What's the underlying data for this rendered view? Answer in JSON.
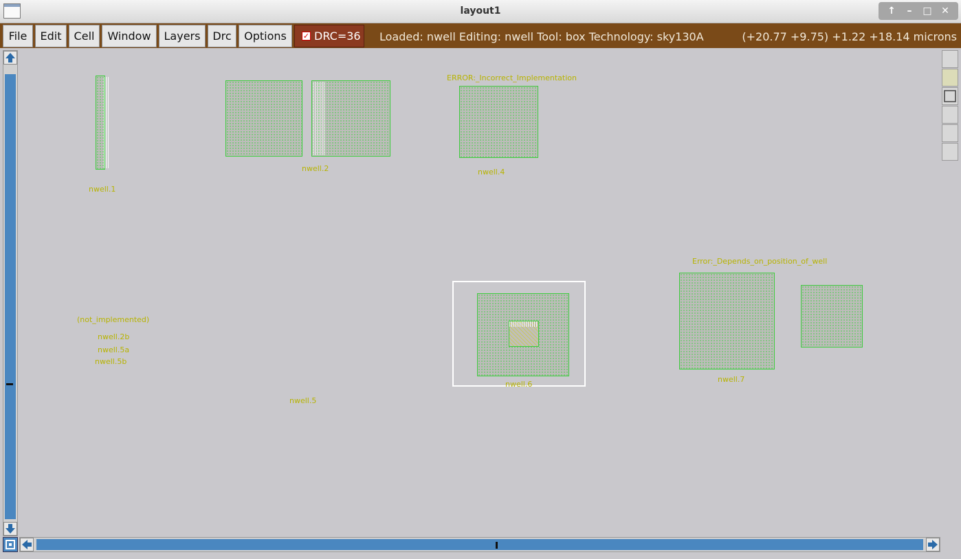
{
  "window": {
    "title": "layout1"
  },
  "menu": [
    "File",
    "Edit",
    "Cell",
    "Window",
    "Layers",
    "Drc",
    "Options"
  ],
  "drc": {
    "label": "DRC=36",
    "checked": true
  },
  "status": {
    "text": "Loaded: nwell Editing: nwell Tool: box  Technology: sky130A",
    "coords": "(+20.77 +9.75) +1.22 +18.14 microns"
  },
  "canvas_labels": {
    "nwell1": "nwell.1",
    "nwell2": "nwell.2",
    "error_incorrect": "ERROR:_Incorrect_Implementation",
    "nwell4": "nwell.4",
    "not_implemented": "(not_implemented)",
    "nwell2b": "nwell.2b",
    "nwell5a": "nwell.5a",
    "nwell5b": "nwell.5b",
    "nwell5": "nwell.5",
    "nwell6": "nwell.6",
    "error_position": "Error:_Depends_on_position_of_well",
    "nwell7": "nwell.7"
  },
  "colors": {
    "menubar": "#7a4a18",
    "drc_button": "#8b3a20",
    "label_yellow": "#b7b300",
    "nwell_outline": "#3ccc3c",
    "scrollbar": "#4a87c0"
  },
  "icons": [
    "app-window-icon",
    "maximize-icon",
    "minimize-icon",
    "restore-icon",
    "close-icon",
    "arrow-up-icon",
    "arrow-down-icon",
    "arrow-left-icon",
    "arrow-right-icon",
    "zoom-box-icon"
  ]
}
